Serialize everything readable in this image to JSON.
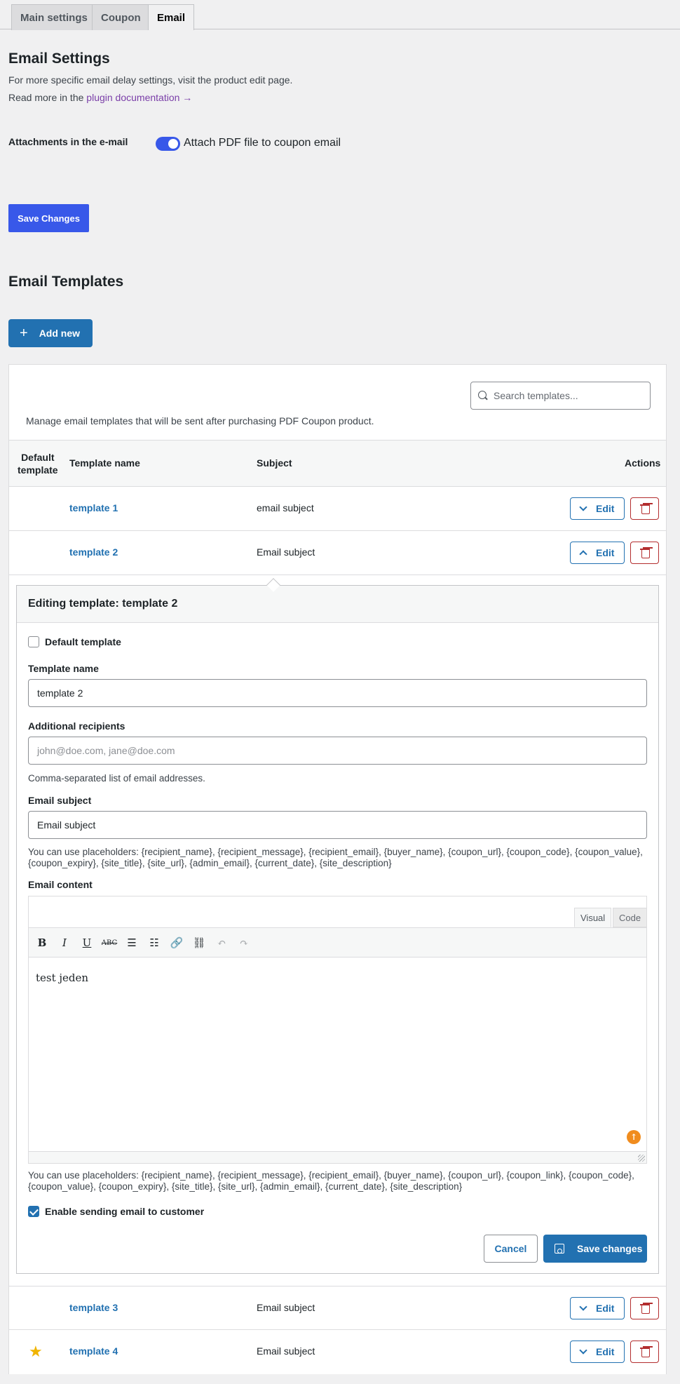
{
  "tabs": [
    {
      "label": "Main settings"
    },
    {
      "label": "Coupon"
    },
    {
      "label": "Email"
    }
  ],
  "settings": {
    "title": "Email Settings",
    "intro": "For more specific email delay settings, visit the product edit page.",
    "read_more_prefix": "Read more in the ",
    "doc_link": "plugin documentation →",
    "attachments_label": "Attachments in the e-mail",
    "attach_toggle_label": "Attach PDF file to coupon email",
    "save_label": "Save Changes"
  },
  "templates": {
    "title": "Email Templates",
    "add_new_label": "Add new",
    "search_placeholder": "Search templates...",
    "description": "Manage email templates that will be sent after purchasing PDF Coupon product.",
    "columns": {
      "default_line1": "Default",
      "default_line2": "template",
      "name": "Template name",
      "subject": "Subject",
      "actions": "Actions"
    },
    "edit_label": "Edit",
    "rows": [
      {
        "name": "template 1",
        "subject": "email subject",
        "default": false
      },
      {
        "name": "template 2",
        "subject": "Email subject",
        "default": false
      },
      {
        "name": "template 3",
        "subject": "Email subject",
        "default": false
      },
      {
        "name": "template 4",
        "subject": "Email subject",
        "default": true
      }
    ]
  },
  "editor": {
    "title": "Editing template: template 2",
    "default_checkbox_label": "Default template",
    "name_label": "Template name",
    "name_value": "template 2",
    "recipients_label": "Additional recipients",
    "recipients_placeholder": "john@doe.com, jane@doe.com",
    "recipients_help": "Comma-separated list of email addresses.",
    "subject_label": "Email subject",
    "subject_value": "Email subject",
    "subject_help": "You can use placeholders: {recipient_name}, {recipient_message}, {recipient_email}, {buyer_name}, {coupon_url}, {coupon_code}, {coupon_value}, {coupon_expiry}, {site_title}, {site_url}, {admin_email}, {current_date}, {site_description}",
    "content_label": "Email content",
    "tab_visual": "Visual",
    "tab_code": "Code",
    "content_value": "test jeden",
    "content_help": "You can use placeholders: {recipient_name}, {recipient_message}, {recipient_email}, {buyer_name}, {coupon_url}, {coupon_link}, {coupon_code}, {coupon_value}, {coupon_expiry}, {site_title}, {site_url}, {admin_email}, {current_date}, {site_description}",
    "enable_label": "Enable sending email to customer",
    "cancel_label": "Cancel",
    "save_label": "Save changes"
  },
  "colors": {
    "primary": "#2271b1",
    "accent": "#3858e9",
    "danger": "#b32d2e",
    "star": "#f0b400"
  }
}
